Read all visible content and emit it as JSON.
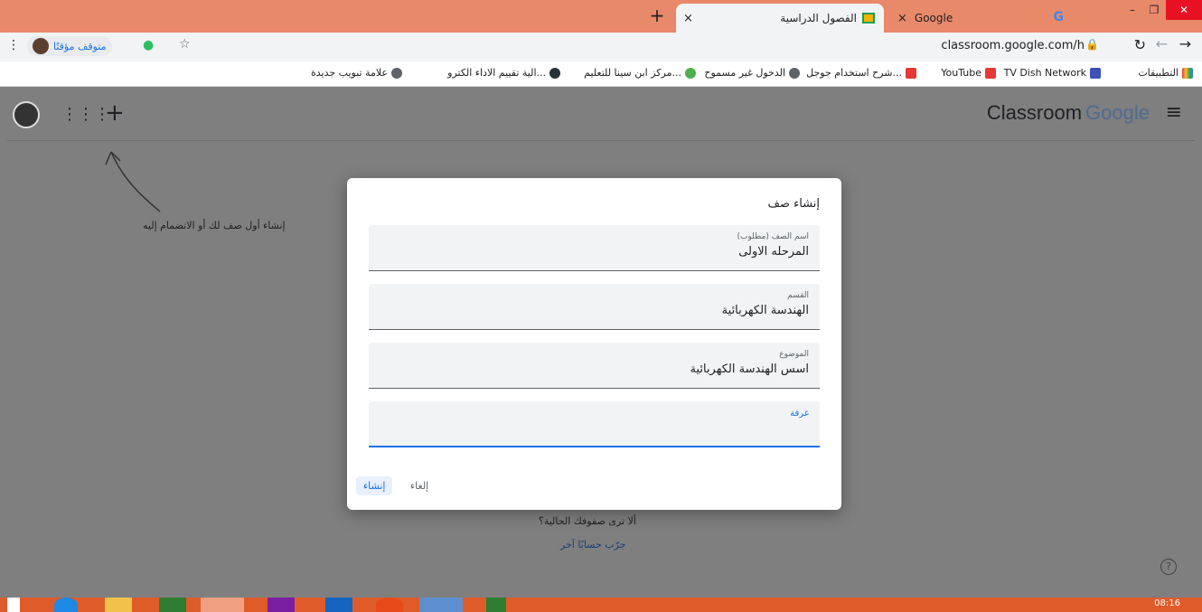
{
  "browser": {
    "tabs": [
      {
        "title": "Google",
        "close": "×"
      },
      {
        "title": "الفصول الدراسية",
        "close": "×"
      }
    ],
    "new_tab": "+",
    "url": "classroom.google.com/h",
    "profile_label": "متوقف مؤقتًا",
    "window_minimize": "–",
    "window_restore": "❐",
    "window_close": "✕"
  },
  "bookmarks": [
    {
      "label": "التطبيقات",
      "icon": "apps-grid-icon",
      "color": "#e53935"
    },
    {
      "label": "TV Dish Network",
      "icon": "tv-icon",
      "color": "#3f51b5"
    },
    {
      "label": "YouTube",
      "icon": "youtube-icon",
      "color": "#e53935"
    },
    {
      "label": "شرح استخدام جوجل...",
      "icon": "youtube-icon",
      "color": "#e53935"
    },
    {
      "label": "الدخول غير مسموح",
      "icon": "globe-icon",
      "color": "#5f6368"
    },
    {
      "label": "مركز ابن سينا للتعليم...",
      "icon": "plant-icon",
      "color": "#4caf50"
    },
    {
      "label": "الية تقييم الاداء الكترو...",
      "icon": "dark-circle-icon",
      "color": "#263238"
    },
    {
      "label": "علامة تبويب جديدة",
      "icon": "globe-icon",
      "color": "#5f6368"
    }
  ],
  "app": {
    "brand_google": "Google",
    "brand_classroom": "Classroom",
    "hint_text": "إنشاء أول صف لك أو الانضمام إليه",
    "bottom_question": "ألا ترى صفوفك الحالية؟",
    "bottom_link": "جرّب حسابًا آخر"
  },
  "dialog": {
    "title": "إنشاء صف",
    "fields": [
      {
        "label": "اسم الصف (مطلوب)",
        "value": "المرحله الاولى"
      },
      {
        "label": "القسم",
        "value": "الهندسة الكهربائية"
      },
      {
        "label": "الموضوع",
        "value": "اسس الهندسة الكهربائية"
      },
      {
        "label": "غرفة",
        "value": ""
      }
    ],
    "cancel_label": "إلغاء",
    "create_label": "إنشاء"
  },
  "taskbar": {
    "time": "08:16"
  }
}
